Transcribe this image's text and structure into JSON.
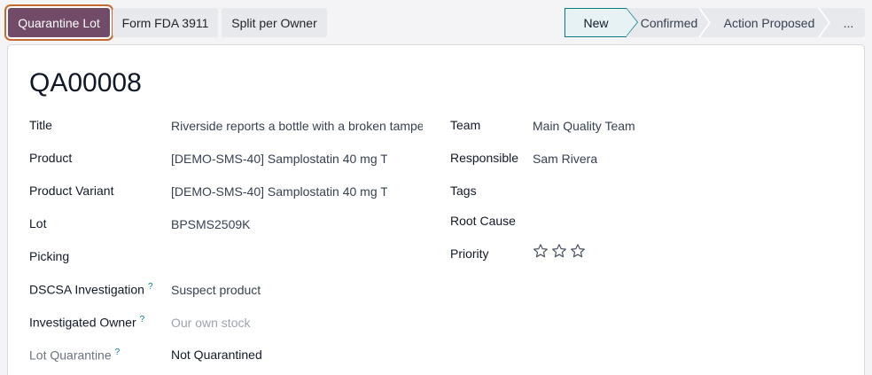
{
  "toolbar": {
    "quarantine_lot": "Quarantine Lot",
    "form_fda": "Form FDA 3911",
    "split_owner": "Split per Owner"
  },
  "statusbar": {
    "stages": [
      "New",
      "Confirmed",
      "Action Proposed",
      "..."
    ],
    "active": "New"
  },
  "record": {
    "name": "QA00008",
    "fields_left": [
      {
        "label": "Title",
        "value": "Riverside reports a bottle with a broken tampe"
      },
      {
        "label": "Product",
        "value": "[DEMO-SMS-40] Samplostatin 40 mg T"
      },
      {
        "label": "Product Variant",
        "value": "[DEMO-SMS-40] Samplostatin 40 mg T"
      },
      {
        "label": "Lot",
        "value": "BPSMS2509K"
      },
      {
        "label": "Picking",
        "value": ""
      },
      {
        "label": "DSCSA Investigation",
        "help": "?",
        "value": "Suspect product"
      },
      {
        "label": "Investigated Owner",
        "help": "?",
        "value": "Our own stock"
      },
      {
        "label": "Lot Quarantine",
        "help": "?",
        "value": "Not Quarantined"
      }
    ],
    "fields_right": [
      {
        "label": "Team",
        "value": "Main Quality Team"
      },
      {
        "label": "Responsible",
        "value": "Sam Rivera"
      },
      {
        "label": "Tags",
        "value": ""
      },
      {
        "label": "Root Cause",
        "value": ""
      },
      {
        "label": "Priority",
        "value": ""
      }
    ],
    "priority_stars": 0,
    "priority_max": 3
  },
  "colors": {
    "primary": "#714b67",
    "focus_ring": "#c66a2e",
    "accent": "#017e84"
  }
}
